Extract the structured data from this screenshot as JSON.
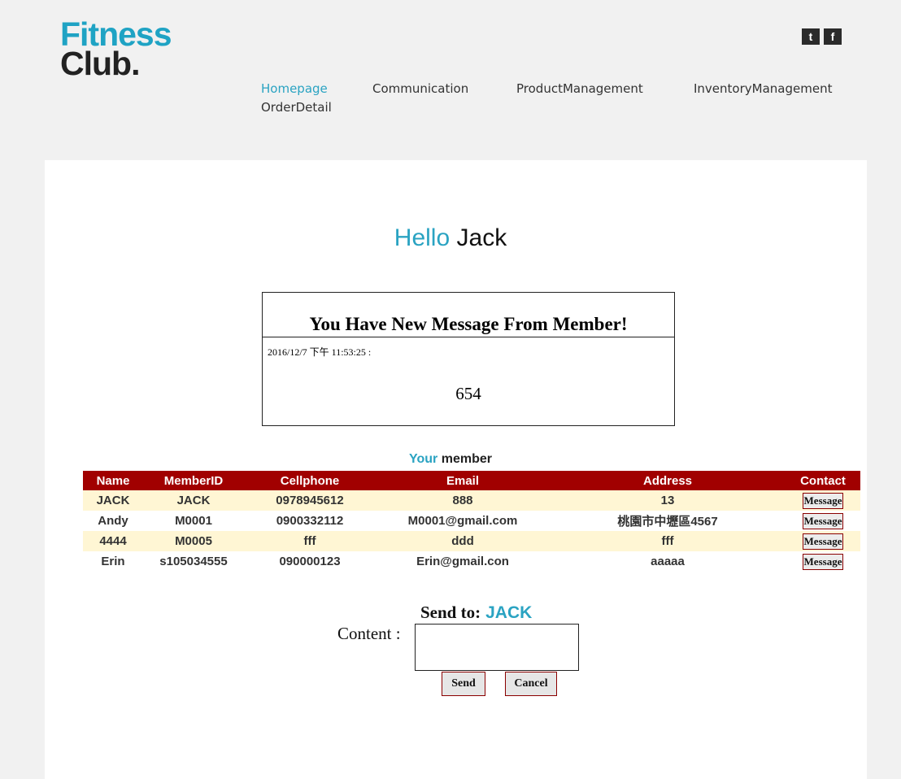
{
  "brand": {
    "line1": "Fitness",
    "line2": "Club."
  },
  "social": [
    {
      "icon": "twitter-icon",
      "glyph": "t"
    },
    {
      "icon": "facebook-icon",
      "glyph": "f"
    }
  ],
  "nav": {
    "items": [
      "Homepage",
      "Communication",
      "ProductManagement",
      "InventoryManagement",
      "OrderDetail"
    ],
    "active": "Homepage"
  },
  "greeting": {
    "hello": "Hello",
    "name": "Jack"
  },
  "message_box": {
    "title": "You Have New Message From Member!",
    "timestamp": "2016/12/7 下午 11:53:25 :",
    "body": "654"
  },
  "members_section": {
    "title_accent": "Your",
    "title_rest": "member"
  },
  "table": {
    "columns": [
      "Name",
      "MemberID",
      "Cellphone",
      "Email",
      "Address",
      "Contact"
    ],
    "rows": [
      [
        "JACK",
        "JACK",
        "0978945612",
        "888",
        "13"
      ],
      [
        "Andy",
        "M0001",
        "0900332112",
        "M0001@gmail.com",
        "桃園市中壢區4567"
      ],
      [
        "4444",
        "M0005",
        "fff",
        "ddd",
        "fff"
      ],
      [
        "Erin",
        "s105034555",
        "090000123",
        "Erin@gmail.con",
        "aaaaa"
      ]
    ],
    "row_button_label": "Message"
  },
  "send_form": {
    "send_to_label": "Send to:",
    "send_to_name": "JACK",
    "content_label": "Content :",
    "content_value": "",
    "send_label": "Send",
    "cancel_label": "Cancel"
  },
  "colors": {
    "accent": "#2aa3c2",
    "header_red": "#a10000",
    "row_alt": "#fff6d4"
  }
}
